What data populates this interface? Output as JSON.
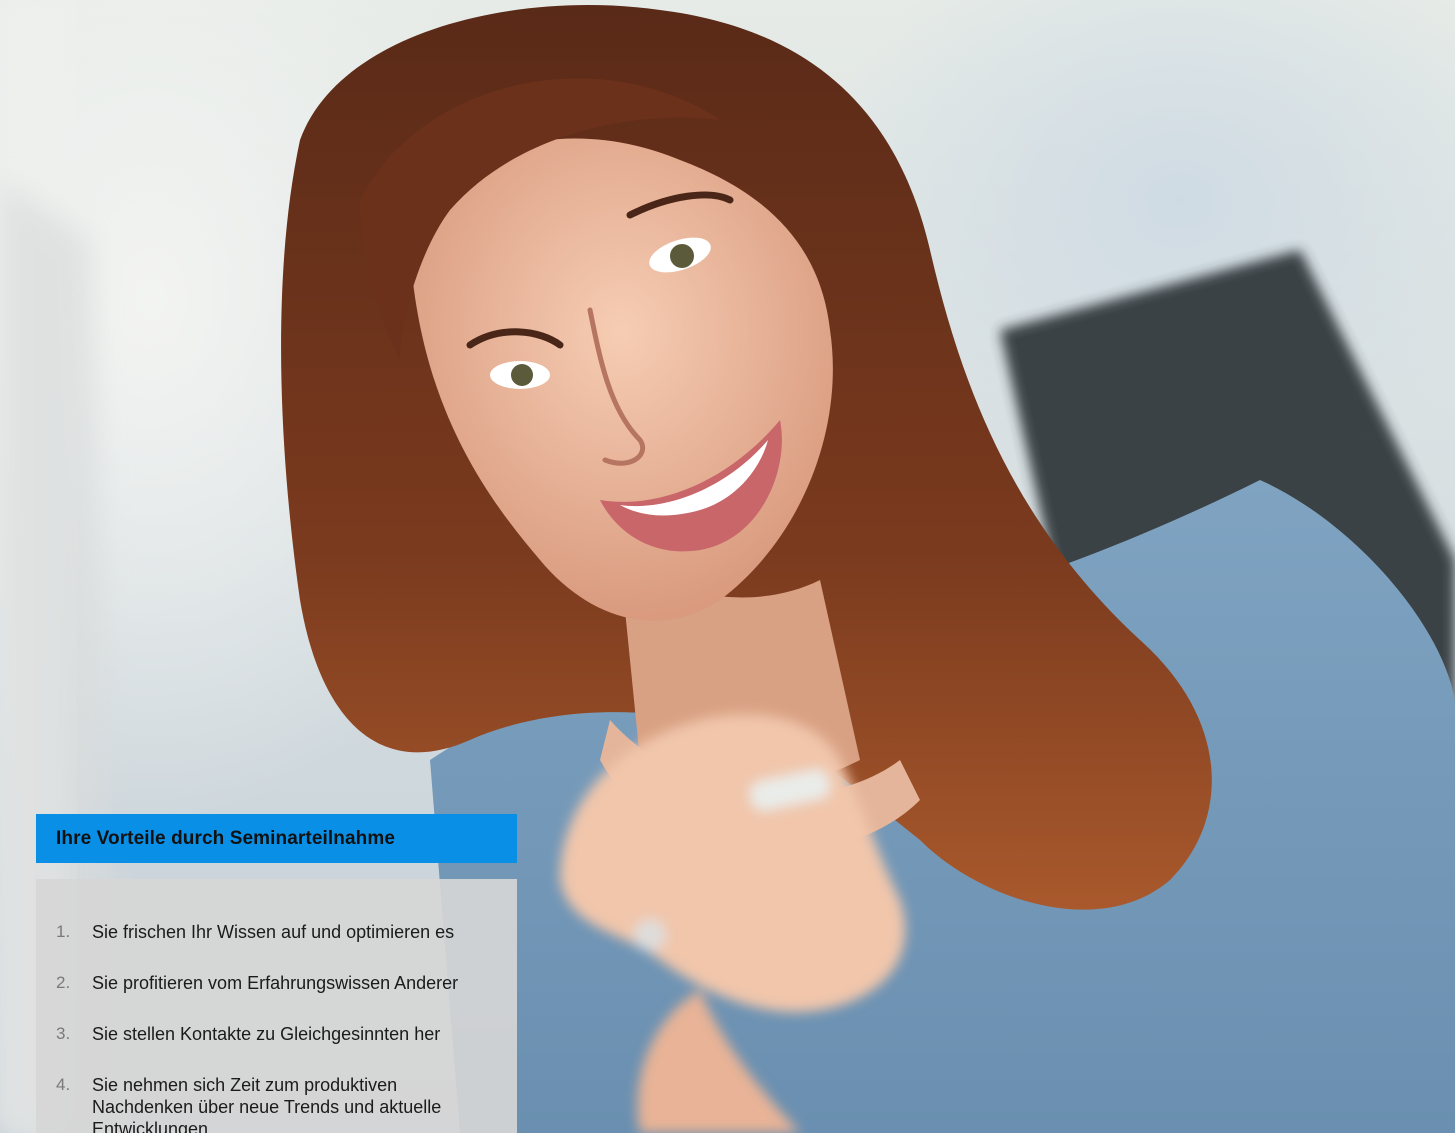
{
  "photo": {
    "subject": "smiling-woman-portrait",
    "accent_color": "#0a8fe6"
  },
  "panel": {
    "title": "Ihre Vorteile durch Seminarteilnahme",
    "items": [
      {
        "number": "1.",
        "text": "Sie frischen Ihr Wissen auf und optimieren es"
      },
      {
        "number": "2.",
        "text": "Sie profitieren vom Erfahrungswissen Anderer"
      },
      {
        "number": "3.",
        "text": "Sie stellen Kontakte zu Gleichgesinnten her"
      },
      {
        "number": "4.",
        "text": "Sie nehmen sich Zeit zum produktiven Nachdenken über neue Trends und aktuelle Entwicklungen"
      }
    ]
  }
}
